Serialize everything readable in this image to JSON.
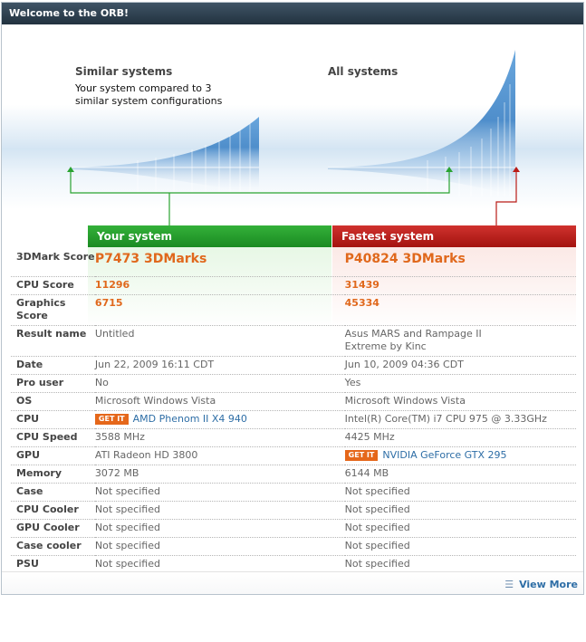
{
  "title": "Welcome to the ORB!",
  "hero": {
    "similar_label": "Similar systems",
    "similar_sub": "Your system compared to 3 similar system configurations",
    "all_label": "All systems"
  },
  "columns": {
    "yours": "Your system",
    "fastest": "Fastest system"
  },
  "get_it": "GET IT",
  "rows": [
    {
      "label": "3DMark Score",
      "yours": "P7473 3DMarks",
      "fastest": "P40824 3DMarks"
    },
    {
      "label": "CPU Score",
      "yours": "11296",
      "fastest": "31439"
    },
    {
      "label": "Graphics Score",
      "yours": "6715",
      "fastest": "45334"
    },
    {
      "label": "Result name",
      "yours": "Untitled",
      "fastest": "Asus MARS and Rampage II Extreme by Kinc"
    },
    {
      "label": "Date",
      "yours": "Jun 22, 2009 16:11 CDT",
      "fastest": "Jun 10, 2009 04:36 CDT"
    },
    {
      "label": "Pro user",
      "yours": "No",
      "fastest": "Yes"
    },
    {
      "label": "OS",
      "yours": "Microsoft Windows Vista",
      "fastest": "Microsoft Windows Vista"
    },
    {
      "label": "CPU",
      "yours": "AMD Phenom II X4 940",
      "fastest": "Intel(R) Core(TM) i7 CPU 975 @ 3.33GHz"
    },
    {
      "label": "CPU Speed",
      "yours": "3588 MHz",
      "fastest": "4425 MHz"
    },
    {
      "label": "GPU",
      "yours": "ATI Radeon HD 3800",
      "fastest": "NVIDIA GeForce GTX 295"
    },
    {
      "label": "Memory",
      "yours": "3072 MB",
      "fastest": "6144 MB"
    },
    {
      "label": "Case",
      "yours": "Not specified",
      "fastest": "Not specified"
    },
    {
      "label": "CPU Cooler",
      "yours": "Not specified",
      "fastest": "Not specified"
    },
    {
      "label": "GPU Cooler",
      "yours": "Not specified",
      "fastest": "Not specified"
    },
    {
      "label": "Case cooler",
      "yours": "Not specified",
      "fastest": "Not specified"
    },
    {
      "label": "PSU",
      "yours": "Not specified",
      "fastest": "Not specified"
    }
  ],
  "view_more": "View More",
  "icons": {
    "view_more": "list-icon",
    "pointer": "arrow-up-icon"
  },
  "colors": {
    "your_system": "#2aa331",
    "fastest_system": "#b91c17",
    "score": "#e0681c",
    "link": "#2e6ea6"
  }
}
